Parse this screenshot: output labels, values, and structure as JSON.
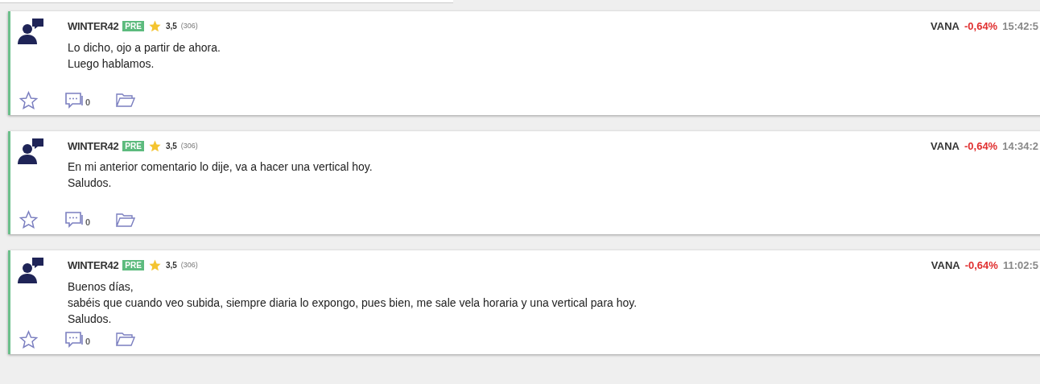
{
  "posts": [
    {
      "user": "WINTER42",
      "badge": "PRE",
      "rating": "3,5",
      "votes": "(306)",
      "ticker": "VANA",
      "change": "-0,64%",
      "time": "15:42:5",
      "lines": [
        "Lo dicho, ojo a partir de ahora.",
        "Luego hablamos."
      ],
      "comments": "0"
    },
    {
      "user": "WINTER42",
      "badge": "PRE",
      "rating": "3,5",
      "votes": "(306)",
      "ticker": "VANA",
      "change": "-0,64%",
      "time": "14:34:2",
      "lines": [
        "En mi anterior comentario lo dije, va a hacer una vertical hoy.",
        "Saludos."
      ],
      "comments": "0"
    },
    {
      "user": "WINTER42",
      "badge": "PRE",
      "rating": "3,5",
      "votes": "(306)",
      "ticker": "VANA",
      "change": "-0,64%",
      "time": "11:02:5",
      "lines": [
        "Buenos días,",
        "sabéis que cuando veo subida, siempre diaria lo expongo, pues bien, me sale vela horaria y una vertical para hoy.",
        "Saludos."
      ],
      "comments": "0"
    }
  ]
}
